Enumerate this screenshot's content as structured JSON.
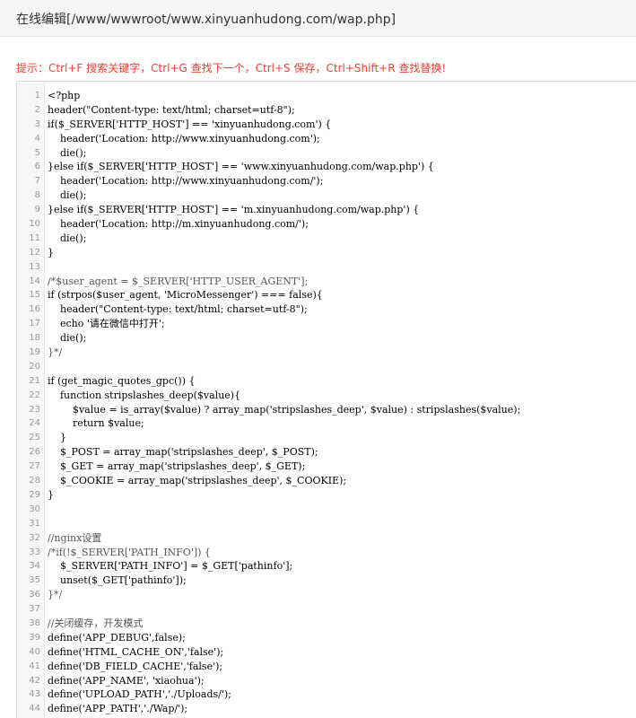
{
  "header": {
    "title": "在线编辑[/www/wwwroot/www.xinyuanhudong.com/wap.php]"
  },
  "tip": "提示：Ctrl+F 搜索关键字，Ctrl+G 查找下一个，Ctrl+S 保存，Ctrl+Shift+R 查找替换!",
  "editor": {
    "lines": [
      {
        "n": "1",
        "code": "<?php"
      },
      {
        "n": "2",
        "code": "header(\"Content-type: text/html; charset=utf-8\");"
      },
      {
        "n": "3",
        "code": "if($_SERVER['HTTP_HOST'] == 'xinyuanhudong.com') {"
      },
      {
        "n": "4",
        "code": "    header('Location: http://www.xinyuanhudong.com');"
      },
      {
        "n": "5",
        "code": "    die();"
      },
      {
        "n": "6",
        "code": "}else if($_SERVER['HTTP_HOST'] == 'www.xinyuanhudong.com/wap.php') {"
      },
      {
        "n": "7",
        "code": "    header('Location: http://www.xinyuanhudong.com/');"
      },
      {
        "n": "8",
        "code": "    die();"
      },
      {
        "n": "9",
        "code": "}else if($_SERVER['HTTP_HOST'] == 'm.xinyuanhudong.com/wap.php') {"
      },
      {
        "n": "10",
        "code": "    header('Location: http://m.xinyuanhudong.com/');"
      },
      {
        "n": "11",
        "code": "    die();"
      },
      {
        "n": "12",
        "code": "}"
      },
      {
        "n": "13",
        "code": ""
      },
      {
        "n": "14",
        "code": "/*$user_agent = $_SERVER['HTTP_USER_AGENT'];"
      },
      {
        "n": "15",
        "code": "if (strpos($user_agent, 'MicroMessenger') === false){"
      },
      {
        "n": "16",
        "code": "    header(\"Content-type: text/html; charset=utf-8\");"
      },
      {
        "n": "17",
        "code": "    echo '请在微信中打开';"
      },
      {
        "n": "18",
        "code": "    die();"
      },
      {
        "n": "19",
        "code": "}*/"
      },
      {
        "n": "20",
        "code": ""
      },
      {
        "n": "21",
        "code": "if (get_magic_quotes_gpc()) {"
      },
      {
        "n": "22",
        "code": "    function stripslashes_deep($value){"
      },
      {
        "n": "23",
        "code": "        $value = is_array($value) ? array_map('stripslashes_deep', $value) : stripslashes($value);"
      },
      {
        "n": "24",
        "code": "        return $value;"
      },
      {
        "n": "25",
        "code": "    }"
      },
      {
        "n": "26",
        "code": "    $_POST = array_map('stripslashes_deep', $_POST);"
      },
      {
        "n": "27",
        "code": "    $_GET = array_map('stripslashes_deep', $_GET);"
      },
      {
        "n": "28",
        "code": "    $_COOKIE = array_map('stripslashes_deep', $_COOKIE);"
      },
      {
        "n": "29",
        "code": "}"
      },
      {
        "n": "30",
        "code": ""
      },
      {
        "n": "31",
        "code": ""
      },
      {
        "n": "32",
        "code": "//nginx设置"
      },
      {
        "n": "33",
        "code": "/*if(!$_SERVER['PATH_INFO']) {"
      },
      {
        "n": "34",
        "code": "    $_SERVER['PATH_INFO'] = $_GET['pathinfo'];"
      },
      {
        "n": "35",
        "code": "    unset($_GET['pathinfo']);"
      },
      {
        "n": "36",
        "code": "}*/"
      },
      {
        "n": "37",
        "code": ""
      },
      {
        "n": "38",
        "code": "//关闭缓存，开发模式"
      },
      {
        "n": "39",
        "code": "define('APP_DEBUG',false);"
      },
      {
        "n": "40",
        "code": "define('HTML_CACHE_ON','false');"
      },
      {
        "n": "41",
        "code": "define('DB_FIELD_CACHE','false');"
      },
      {
        "n": "42",
        "code": "define('APP_NAME', 'xiaohua');"
      },
      {
        "n": "43",
        "code": "define('UPLOAD_PATH','./Uploads/');"
      },
      {
        "n": "44",
        "code": "define('APP_PATH','./Wap/');"
      }
    ]
  }
}
